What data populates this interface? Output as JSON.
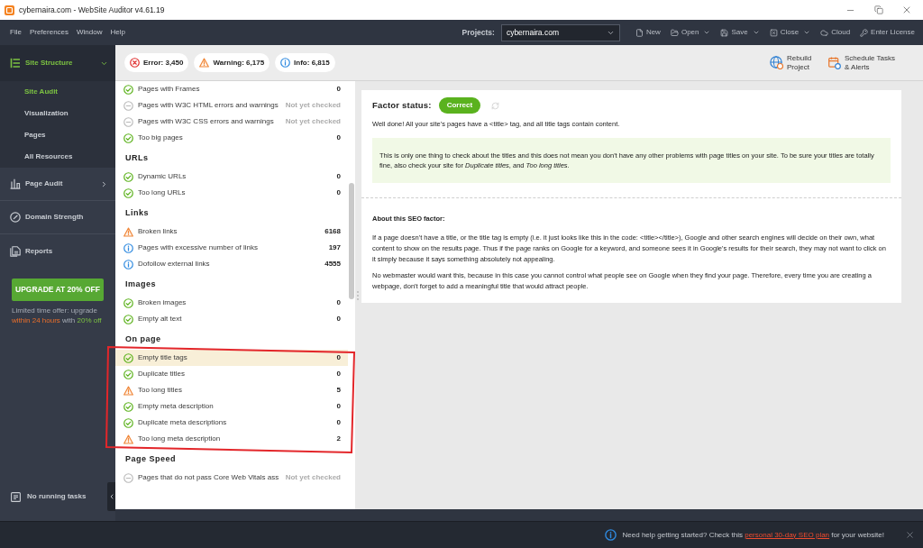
{
  "window": {
    "title": "cybernaira.com - WebSite Auditor v4.61.19"
  },
  "menu": [
    "File",
    "Preferences",
    "Window",
    "Help"
  ],
  "projects": {
    "label": "Projects:",
    "value": "cybernaira.com"
  },
  "actions": [
    {
      "label": "New",
      "dropdown": false
    },
    {
      "label": "Open",
      "dropdown": true
    },
    {
      "label": "Save",
      "dropdown": true
    },
    {
      "label": "Close",
      "dropdown": true
    },
    {
      "label": "Cloud",
      "dropdown": false
    },
    {
      "label": "Enter License",
      "dropdown": false
    }
  ],
  "sidebar": {
    "items": [
      {
        "label": "Site Structure",
        "selected": true,
        "expanded": true,
        "children": [
          {
            "label": "Site Audit",
            "selected": true
          },
          {
            "label": "Visualization",
            "selected": false
          },
          {
            "label": "Pages",
            "selected": false
          },
          {
            "label": "All Resources",
            "selected": false
          }
        ]
      },
      {
        "label": "Page Audit",
        "selected": false,
        "expanded": false
      },
      {
        "label": "Domain Strength",
        "selected": false
      },
      {
        "label": "Reports",
        "selected": false
      }
    ],
    "upgrade": {
      "button": "UPGRADE AT 20% OFF",
      "offer": [
        {
          "kind": "plain",
          "text": "Limited time offer: upgrade"
        },
        {
          "kind": "deadline",
          "text": "within 24 hours"
        },
        {
          "kind": "plain",
          "text": "with"
        },
        {
          "kind": "discount",
          "text": "20% off"
        }
      ]
    },
    "tasks": "No running tasks"
  },
  "summary": {
    "badges": [
      {
        "kind": "error",
        "label": "Error: 3,450"
      },
      {
        "kind": "warning",
        "label": "Warning: 6,175"
      },
      {
        "kind": "info",
        "label": "Info: 6,815"
      }
    ],
    "actions": [
      "Rebuild Project",
      "Schedule Tasks & Alerts"
    ]
  },
  "factors": {
    "groups": [
      {
        "framed": false,
        "rows": [
          {
            "label": "Pages with Frames",
            "value": "0",
            "kind": "ok",
            "selected": false
          },
          {
            "label": "Pages with W3C HTML errors and warnings",
            "value": "Not yet checked",
            "kind": "unchecked",
            "selected": false
          },
          {
            "label": "Pages with W3C CSS errors and warnings",
            "value": "Not yet checked",
            "kind": "unchecked",
            "selected": false
          },
          {
            "label": "Too big pages",
            "value": "0",
            "kind": "ok",
            "selected": false
          }
        ]
      },
      {
        "title": "URLs",
        "framed": false,
        "rows": [
          {
            "label": "Dynamic URLs",
            "value": "0",
            "kind": "ok",
            "selected": false
          },
          {
            "label": "Too long URLs",
            "value": "0",
            "kind": "ok",
            "selected": false
          }
        ]
      },
      {
        "title": "Links",
        "framed": false,
        "rows": [
          {
            "label": "Broken links",
            "value": "6168",
            "kind": "warning",
            "selected": false
          },
          {
            "label": "Pages with excessive number of links",
            "value": "197",
            "kind": "info",
            "selected": false
          },
          {
            "label": "Dofollow external links",
            "value": "4555",
            "kind": "info",
            "selected": false
          }
        ]
      },
      {
        "title": "Images",
        "framed": false,
        "rows": [
          {
            "label": "Broken images",
            "value": "0",
            "kind": "ok",
            "selected": false
          },
          {
            "label": "Empty alt text",
            "value": "0",
            "kind": "ok",
            "selected": false
          }
        ]
      },
      {
        "title": "On page",
        "framed": true,
        "rows": [
          {
            "label": "Empty title tags",
            "value": "0",
            "kind": "ok",
            "selected": true
          },
          {
            "label": "Duplicate titles",
            "value": "0",
            "kind": "ok",
            "selected": false
          },
          {
            "label": "Too long titles",
            "value": "5",
            "kind": "warning",
            "selected": false
          },
          {
            "label": "Empty meta description",
            "value": "0",
            "kind": "ok",
            "selected": false
          },
          {
            "label": "Duplicate meta descriptions",
            "value": "0",
            "kind": "ok",
            "selected": false
          },
          {
            "label": "Too long meta description",
            "value": "2",
            "kind": "warning",
            "selected": false
          }
        ]
      },
      {
        "title": "Page Speed",
        "framed": false,
        "rows": [
          {
            "label": "Pages that do not pass Core Web Vitals ass",
            "value": "Not yet checked",
            "kind": "unchecked",
            "selected": false
          }
        ]
      }
    ]
  },
  "details": {
    "status_label": "Factor status:",
    "status": {
      "kind": "correct",
      "label": "Correct"
    },
    "summary": "Well done! All your site's pages have a <title> tag, and all title tags contain content.",
    "note": "This is only one thing to check about the titles and this does not mean you don't have any other problems with page titles on your site. To be sure your titles are totally fine, also check your site for *Duplicate titles*, and *Too long titles*.",
    "about_title": "About this SEO factor:",
    "about": [
      "If a page doesn't have a title, or the title tag is empty (i.e. it just looks like this in the code: <title></title>), Google and other search engines will decide on their own, what content to show on the results page. Thus if the page ranks on Google for a keyword, and someone sees it in Google's results for their search, they may not want to click on it simply because it says something absolutely not appealing.",
      "No webmaster would want this, because in this case you cannot control what people see on Google when they find your page. Therefore, every time you are creating a webpage, don't forget to add a meaningful title that would attract people."
    ]
  },
  "help_bar": {
    "before": "Need help getting started? Check this",
    "link": "personal 30-day SEO plan",
    "after": "for your website!"
  }
}
